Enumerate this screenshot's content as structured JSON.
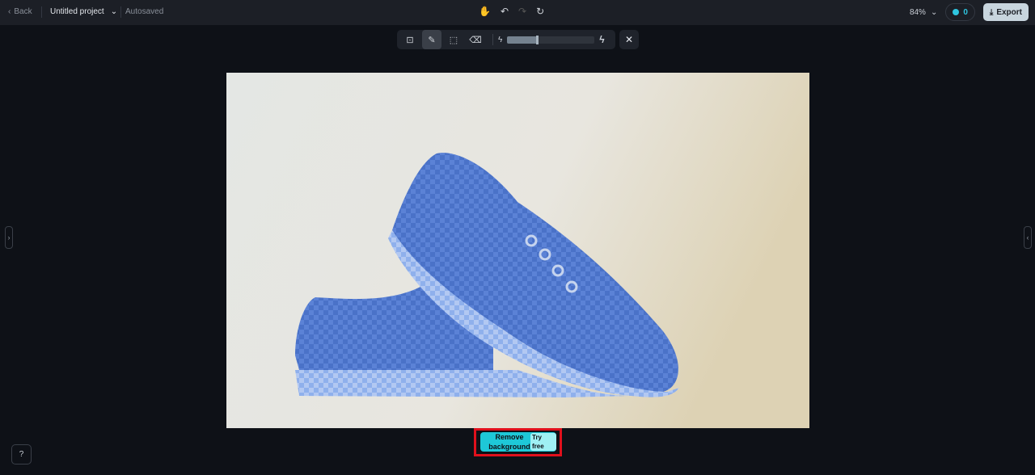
{
  "header": {
    "back_label": "Back",
    "project_title": "Untitled project",
    "status": "Autosaved",
    "zoom": "84%",
    "credits": "0",
    "export_label": "Export"
  },
  "toolbar": {
    "tools": [
      "person-select-icon",
      "brush-icon",
      "lasso-select-icon",
      "eraser-icon"
    ],
    "active_tool": "brush-icon",
    "brush_size_percent": 34
  },
  "action": {
    "remove_bg_label": "Remove background",
    "badge": "Try free"
  },
  "colors": {
    "accent": "#1ec8d8",
    "highlight_frame": "#e0101c",
    "mask": "#3b6fd6"
  }
}
